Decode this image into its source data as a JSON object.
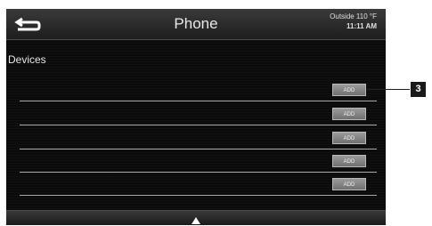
{
  "header": {
    "title": "Phone",
    "back_icon": "back-arrow-icon",
    "outside_label": "Outside 110 °F",
    "time": "11:11 AM"
  },
  "section": {
    "title": "Devices"
  },
  "rows": [
    {
      "button_label": "ADD"
    },
    {
      "button_label": "ADD"
    },
    {
      "button_label": "ADD"
    },
    {
      "button_label": "ADD"
    },
    {
      "button_label": "ADD"
    }
  ],
  "footer": {
    "scroll_icon": "triangle-up-icon"
  },
  "callout": {
    "label": "3"
  },
  "colors": {
    "screen_bg": "#0b0b0b",
    "header_bg": "#2c2c2c",
    "text": "#e8e8e8",
    "divider": "#a9a9a9",
    "button_bg": "#858585"
  }
}
